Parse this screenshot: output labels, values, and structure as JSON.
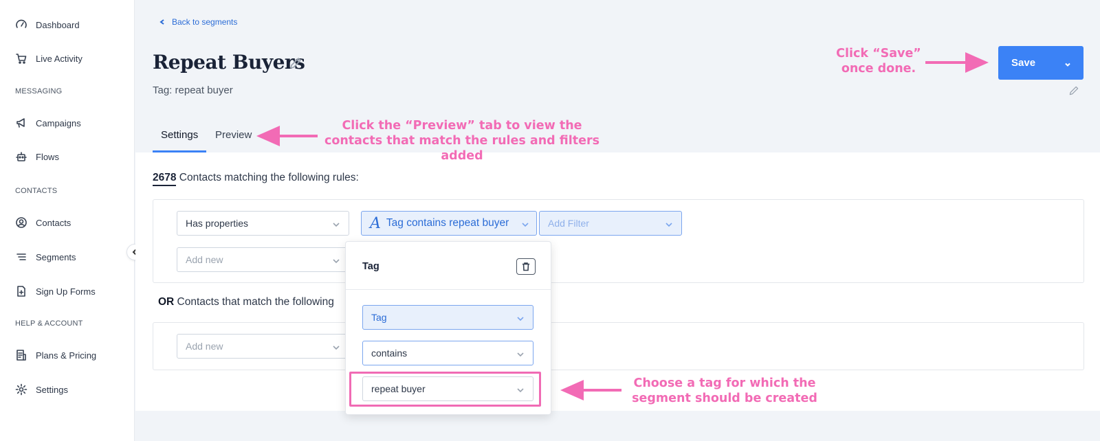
{
  "sidebar": {
    "items": [
      {
        "label": "Dashboard",
        "icon": "gauge-icon"
      },
      {
        "label": "Live Activity",
        "icon": "cart-icon"
      },
      {
        "label": "Campaigns",
        "icon": "megaphone-icon"
      },
      {
        "label": "Flows",
        "icon": "robot-icon"
      },
      {
        "label": "Contacts",
        "icon": "user-circle-icon"
      },
      {
        "label": "Segments",
        "icon": "list-icon"
      },
      {
        "label": "Sign Up Forms",
        "icon": "file-plus-icon"
      },
      {
        "label": "Plans & Pricing",
        "icon": "receipt-icon"
      },
      {
        "label": "Settings",
        "icon": "gear-icon"
      }
    ],
    "sections": {
      "messaging": "MESSAGING",
      "contacts": "CONTACTS",
      "help": "HELP & ACCOUNT"
    }
  },
  "header": {
    "back_link": "Back to segments",
    "title": "Repeat Buyers",
    "subtitle": "Tag: repeat buyer",
    "save_label": "Save"
  },
  "tabs": [
    {
      "label": "Settings",
      "active": true
    },
    {
      "label": "Preview",
      "active": false
    }
  ],
  "rules": {
    "count": "2678",
    "count_text": " Contacts matching the following rules:",
    "group1": {
      "property_select": "Has properties",
      "tag_chip_icon": "A",
      "tag_chip_label": "Tag contains repeat buyer",
      "add_filter": "Add Filter",
      "add_new": "Add new"
    },
    "or_prefix": "OR",
    "or_text": " Contacts that match the following",
    "group2": {
      "add_new": "Add new"
    }
  },
  "popover": {
    "title": "Tag",
    "field_select": "Tag",
    "operator_select": "contains",
    "value_select": "repeat buyer"
  },
  "annotations": {
    "save": "Click “Save” once done.",
    "preview": "Click the “Preview” tab to view the contacts that match the rules and filters added",
    "tag": "Choose a tag for which the segment should be created"
  },
  "colors": {
    "accent": "#3b82f6",
    "annotation": "#f26bb5",
    "chip_bg": "#e8f0fc"
  }
}
